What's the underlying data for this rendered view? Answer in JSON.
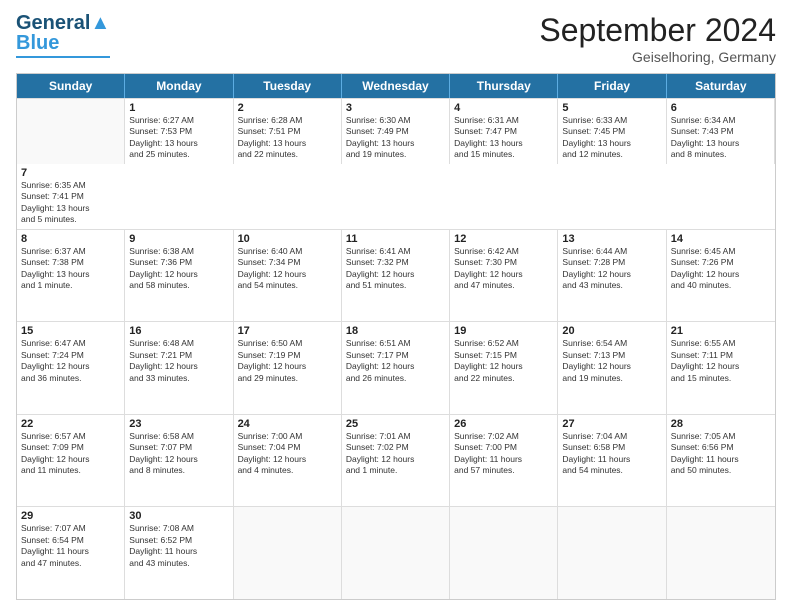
{
  "header": {
    "logo_line1": "General",
    "logo_line2": "Blue",
    "month": "September 2024",
    "location": "Geiselhoring, Germany"
  },
  "days": [
    "Sunday",
    "Monday",
    "Tuesday",
    "Wednesday",
    "Thursday",
    "Friday",
    "Saturday"
  ],
  "rows": [
    [
      {
        "num": "",
        "text": "",
        "empty": true
      },
      {
        "num": "1",
        "text": "Sunrise: 6:27 AM\nSunset: 7:53 PM\nDaylight: 13 hours\nand 25 minutes."
      },
      {
        "num": "2",
        "text": "Sunrise: 6:28 AM\nSunset: 7:51 PM\nDaylight: 13 hours\nand 22 minutes."
      },
      {
        "num": "3",
        "text": "Sunrise: 6:30 AM\nSunset: 7:49 PM\nDaylight: 13 hours\nand 19 minutes."
      },
      {
        "num": "4",
        "text": "Sunrise: 6:31 AM\nSunset: 7:47 PM\nDaylight: 13 hours\nand 15 minutes."
      },
      {
        "num": "5",
        "text": "Sunrise: 6:33 AM\nSunset: 7:45 PM\nDaylight: 13 hours\nand 12 minutes."
      },
      {
        "num": "6",
        "text": "Sunrise: 6:34 AM\nSunset: 7:43 PM\nDaylight: 13 hours\nand 8 minutes."
      },
      {
        "num": "7",
        "text": "Sunrise: 6:35 AM\nSunset: 7:41 PM\nDaylight: 13 hours\nand 5 minutes."
      }
    ],
    [
      {
        "num": "8",
        "text": "Sunrise: 6:37 AM\nSunset: 7:38 PM\nDaylight: 13 hours\nand 1 minute."
      },
      {
        "num": "9",
        "text": "Sunrise: 6:38 AM\nSunset: 7:36 PM\nDaylight: 12 hours\nand 58 minutes."
      },
      {
        "num": "10",
        "text": "Sunrise: 6:40 AM\nSunset: 7:34 PM\nDaylight: 12 hours\nand 54 minutes."
      },
      {
        "num": "11",
        "text": "Sunrise: 6:41 AM\nSunset: 7:32 PM\nDaylight: 12 hours\nand 51 minutes."
      },
      {
        "num": "12",
        "text": "Sunrise: 6:42 AM\nSunset: 7:30 PM\nDaylight: 12 hours\nand 47 minutes."
      },
      {
        "num": "13",
        "text": "Sunrise: 6:44 AM\nSunset: 7:28 PM\nDaylight: 12 hours\nand 43 minutes."
      },
      {
        "num": "14",
        "text": "Sunrise: 6:45 AM\nSunset: 7:26 PM\nDaylight: 12 hours\nand 40 minutes."
      }
    ],
    [
      {
        "num": "15",
        "text": "Sunrise: 6:47 AM\nSunset: 7:24 PM\nDaylight: 12 hours\nand 36 minutes."
      },
      {
        "num": "16",
        "text": "Sunrise: 6:48 AM\nSunset: 7:21 PM\nDaylight: 12 hours\nand 33 minutes."
      },
      {
        "num": "17",
        "text": "Sunrise: 6:50 AM\nSunset: 7:19 PM\nDaylight: 12 hours\nand 29 minutes."
      },
      {
        "num": "18",
        "text": "Sunrise: 6:51 AM\nSunset: 7:17 PM\nDaylight: 12 hours\nand 26 minutes."
      },
      {
        "num": "19",
        "text": "Sunrise: 6:52 AM\nSunset: 7:15 PM\nDaylight: 12 hours\nand 22 minutes."
      },
      {
        "num": "20",
        "text": "Sunrise: 6:54 AM\nSunset: 7:13 PM\nDaylight: 12 hours\nand 19 minutes."
      },
      {
        "num": "21",
        "text": "Sunrise: 6:55 AM\nSunset: 7:11 PM\nDaylight: 12 hours\nand 15 minutes."
      }
    ],
    [
      {
        "num": "22",
        "text": "Sunrise: 6:57 AM\nSunset: 7:09 PM\nDaylight: 12 hours\nand 11 minutes."
      },
      {
        "num": "23",
        "text": "Sunrise: 6:58 AM\nSunset: 7:07 PM\nDaylight: 12 hours\nand 8 minutes."
      },
      {
        "num": "24",
        "text": "Sunrise: 7:00 AM\nSunset: 7:04 PM\nDaylight: 12 hours\nand 4 minutes."
      },
      {
        "num": "25",
        "text": "Sunrise: 7:01 AM\nSunset: 7:02 PM\nDaylight: 12 hours\nand 1 minute."
      },
      {
        "num": "26",
        "text": "Sunrise: 7:02 AM\nSunset: 7:00 PM\nDaylight: 11 hours\nand 57 minutes."
      },
      {
        "num": "27",
        "text": "Sunrise: 7:04 AM\nSunset: 6:58 PM\nDaylight: 11 hours\nand 54 minutes."
      },
      {
        "num": "28",
        "text": "Sunrise: 7:05 AM\nSunset: 6:56 PM\nDaylight: 11 hours\nand 50 minutes."
      }
    ],
    [
      {
        "num": "29",
        "text": "Sunrise: 7:07 AM\nSunset: 6:54 PM\nDaylight: 11 hours\nand 47 minutes."
      },
      {
        "num": "30",
        "text": "Sunrise: 7:08 AM\nSunset: 6:52 PM\nDaylight: 11 hours\nand 43 minutes."
      },
      {
        "num": "",
        "text": "",
        "empty": true
      },
      {
        "num": "",
        "text": "",
        "empty": true
      },
      {
        "num": "",
        "text": "",
        "empty": true
      },
      {
        "num": "",
        "text": "",
        "empty": true
      },
      {
        "num": "",
        "text": "",
        "empty": true
      }
    ]
  ]
}
